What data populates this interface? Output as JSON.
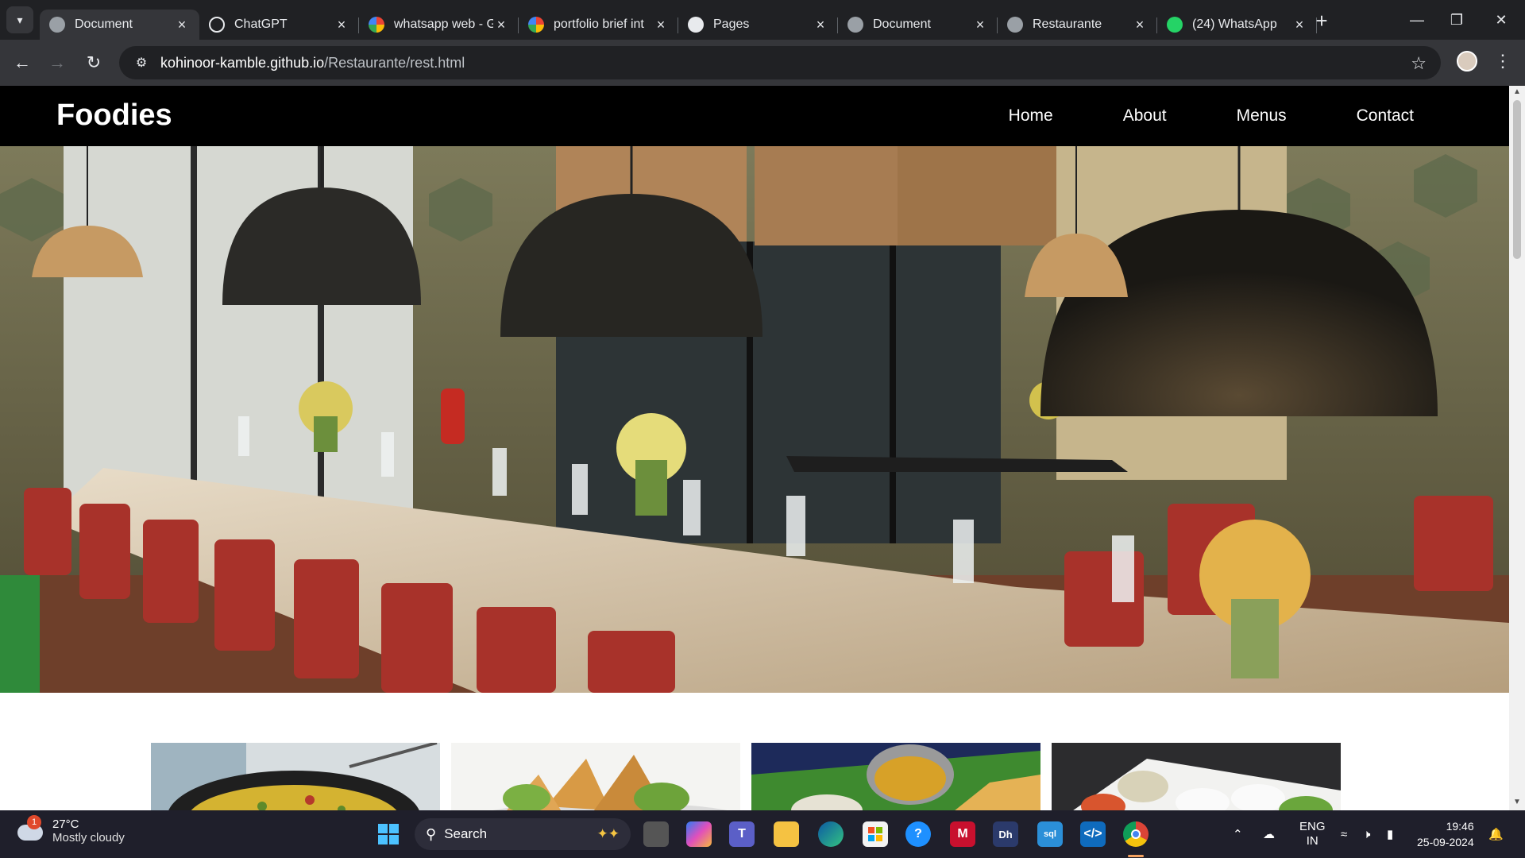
{
  "browser": {
    "tabs": [
      {
        "title": "Document",
        "icon": "globe-icon",
        "active": true
      },
      {
        "title": "ChatGPT",
        "icon": "chatgpt-icon",
        "active": false
      },
      {
        "title": "whatsapp web - G",
        "icon": "google-icon",
        "active": false
      },
      {
        "title": "portfolio brief int",
        "icon": "google-icon",
        "active": false
      },
      {
        "title": "Pages",
        "icon": "github-icon",
        "active": false
      },
      {
        "title": "Document",
        "icon": "globe-icon",
        "active": false
      },
      {
        "title": "Restaurante",
        "icon": "globe-icon",
        "active": false
      },
      {
        "title": "(24) WhatsApp",
        "icon": "whatsapp-icon",
        "active": false
      }
    ],
    "url_host": "kohinoor-kamble.github.io",
    "url_path": "/Restaurante/rest.html"
  },
  "site": {
    "brand": "Foodies",
    "nav": [
      "Home",
      "About",
      "Menus",
      "Contact"
    ],
    "hero_image": "restaurant-interior-photo",
    "cards": [
      "paella-dish-photo",
      "samosa-photo",
      "dosa-thali-photo",
      "idli-chutney-photo"
    ]
  },
  "taskbar": {
    "weather_temp": "27°C",
    "weather_desc": "Mostly cloudy",
    "weather_badge": "1",
    "search_label": "Search",
    "lang_top": "ENG",
    "lang_bottom": "IN",
    "time": "19:46",
    "date": "25-09-2024"
  },
  "colors": {
    "browser_bg": "#202124",
    "toolbar_bg": "#35363a",
    "site_nav_bg": "#000000",
    "taskbar_bg": "#1f1f2b"
  }
}
